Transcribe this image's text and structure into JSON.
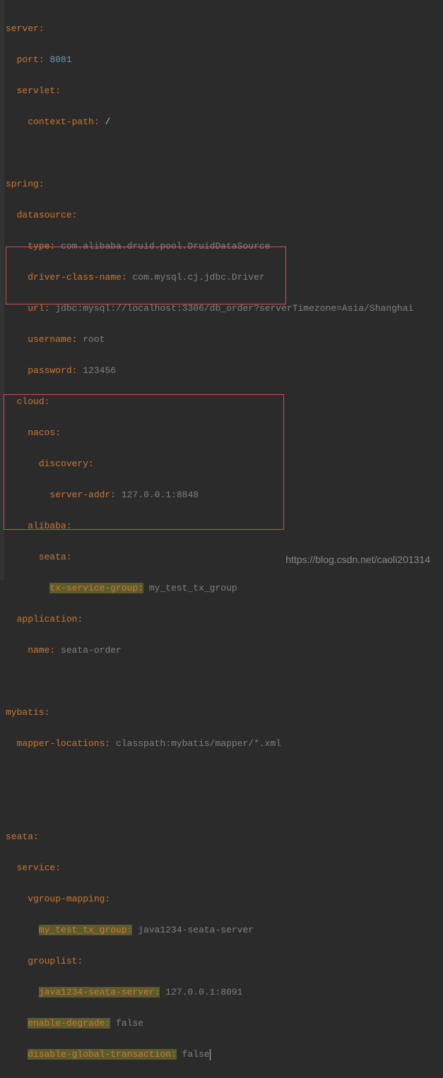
{
  "yaml": {
    "server": {
      "key": "server:",
      "port_key": "port:",
      "port_val": "8081",
      "servlet_key": "servlet:",
      "context_path_key": "context-path:",
      "context_path_val": "/"
    },
    "spring": {
      "key": "spring:",
      "datasource_key": "datasource:",
      "type_key": "type:",
      "type_val": "com.alibaba.druid.pool.DruidDataSource",
      "driver_key": "driver-class-name:",
      "driver_val": "com.mysql.cj.jdbc.Driver",
      "url_key": "url:",
      "url_val": "jdbc:mysql://localhost:3306/db_order?serverTimezone=Asia/Shanghai",
      "username_key": "username:",
      "username_val": "root",
      "password_key": "password:",
      "password_val": "123456",
      "cloud_key": "cloud:",
      "nacos_key": "nacos:",
      "discovery_key": "discovery:",
      "server_addr_key": "server-addr:",
      "server_addr_val": "127.0.0.1:8848",
      "alibaba_key": "alibaba:",
      "seata_key": "seata:",
      "tx_group_key": "tx-service-group:",
      "tx_group_val": "my_test_tx_group",
      "application_key": "application:",
      "name_key": "name:",
      "name_val": "seata-order"
    },
    "mybatis": {
      "key": "mybatis:",
      "mapper_key": "mapper-locations:",
      "mapper_val": "classpath:mybatis/mapper/*.xml"
    },
    "seata": {
      "key": "seata:",
      "service_key": "service:",
      "vgroup_key": "vgroup-mapping:",
      "mytest_key": "my_test_tx_group:",
      "mytest_val": "java1234-seata-server",
      "grouplist_key": "grouplist:",
      "java1234_key": "java1234-seata-server:",
      "java1234_val": "127.0.0.1:8091",
      "degrade_key": "enable-degrade:",
      "degrade_val": "false",
      "disable_key": "disable-global-transaction:",
      "disable_val": "false"
    }
  },
  "watermark": "https://blog.csdn.net/caoli201314"
}
